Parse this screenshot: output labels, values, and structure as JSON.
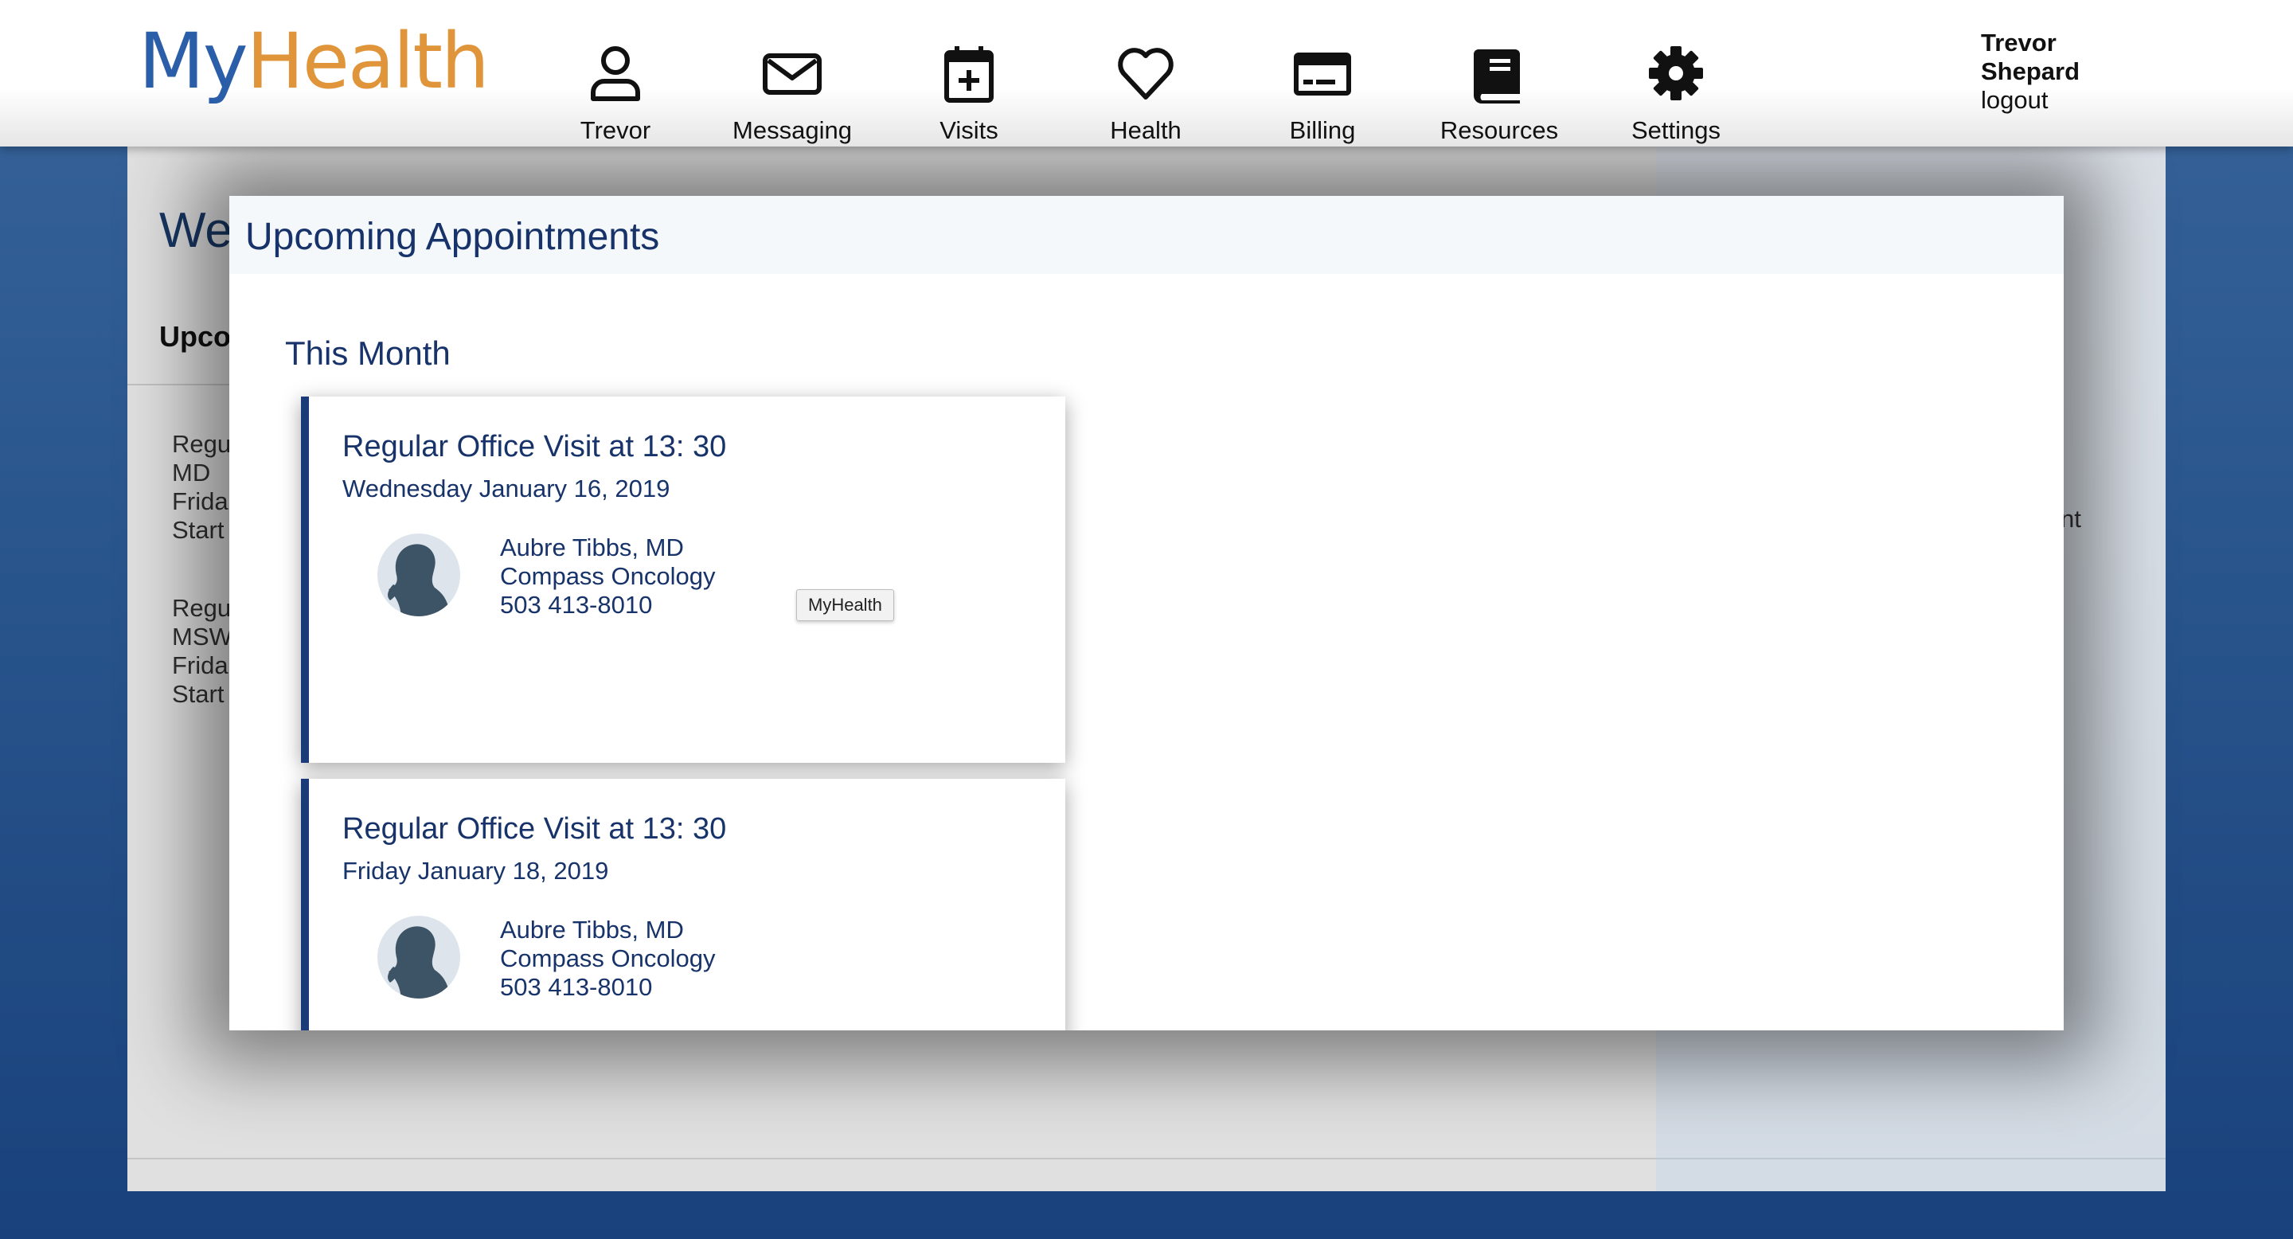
{
  "header": {
    "logo_part1": "My",
    "logo_part2": "Health",
    "nav": [
      {
        "label": "Trevor",
        "icon": "user-icon"
      },
      {
        "label": "Messaging",
        "icon": "envelope-icon"
      },
      {
        "label": "Visits",
        "icon": "calendar-plus-icon"
      },
      {
        "label": "Health",
        "icon": "heart-icon"
      },
      {
        "label": "Billing",
        "icon": "credit-card-icon"
      },
      {
        "label": "Resources",
        "icon": "book-icon"
      },
      {
        "label": "Settings",
        "icon": "gear-icon"
      }
    ],
    "user_first": "Trevor",
    "user_last": "Shepard",
    "logout": "logout"
  },
  "background": {
    "welcome": "We",
    "upcoming": "Upco",
    "list": [
      [
        "Regu",
        "MD",
        "Frida",
        "Start"
      ],
      [
        "Regu",
        "MSW",
        "Frida",
        "Start"
      ]
    ],
    "right_fragment": "nt"
  },
  "modal": {
    "title": "Upcoming Appointments",
    "section": "This Month",
    "appointments": [
      {
        "title": "Regular Office Visit at 13: 30",
        "date": "Wednesday January 16, 2019",
        "doctor": "Aubre Tibbs, MD",
        "clinic": "Compass Oncology",
        "phone": "503 413-8010"
      },
      {
        "title": "Regular Office Visit at 13: 30",
        "date": "Friday January 18, 2019",
        "doctor": "Aubre Tibbs, MD",
        "clinic": "Compass Oncology",
        "phone": "503 413-8010"
      }
    ]
  },
  "tooltip": "MyHealth",
  "colors": {
    "logo_blue": "#2a5ea8",
    "logo_orange": "#e0953a",
    "navy_text": "#17336a",
    "card_accent": "#1b3a78",
    "page_bg_blue": "#1b4683"
  }
}
